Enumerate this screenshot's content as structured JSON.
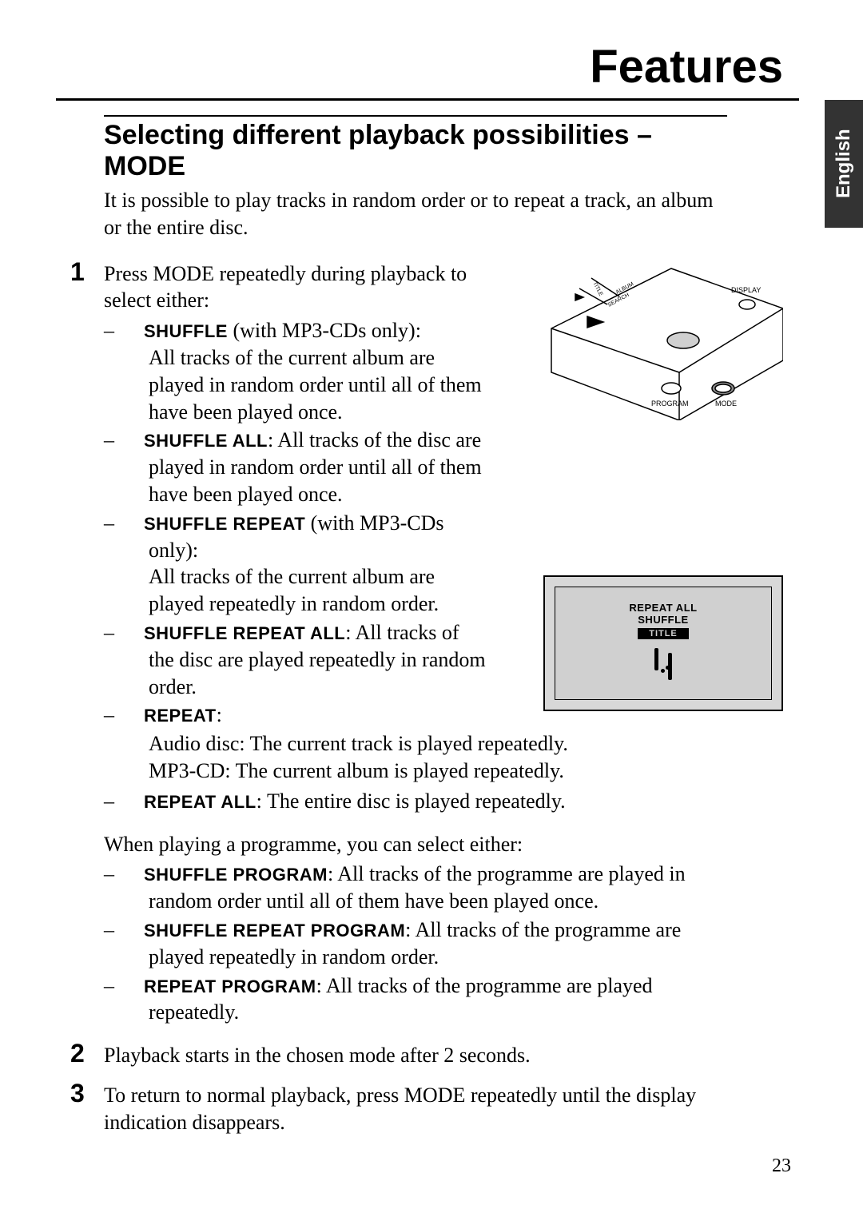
{
  "header": {
    "title": "Features"
  },
  "lang_tab": "English",
  "section": {
    "title": "Selecting different playback possibilities – MODE",
    "intro": "It is possible to play tracks in random order or to repeat a track, an album or the entire disc."
  },
  "step1": {
    "num": "1",
    "lead": "Press MODE repeatedly during playback to select either:",
    "modes": [
      {
        "name": "SHUFFLE",
        "suffix": " (with MP3-CDs only):",
        "desc": "All tracks of the current album are played in random order until all of them have been played once."
      },
      {
        "name": "SHUFFLE ALL",
        "suffix": ": ",
        "desc": "All tracks of the disc are played in random order until all of them have been played once."
      },
      {
        "name": "SHUFFLE REPEAT",
        "suffix": " (with MP3-CDs only):",
        "desc": "All tracks of the current album are played repeatedly in random order."
      },
      {
        "name": "SHUFFLE REPEAT ALL",
        "suffix": ": ",
        "desc": "All tracks of the disc are played repeatedly in random order."
      },
      {
        "name": "REPEAT",
        "suffix": ":",
        "desc": ""
      }
    ],
    "repeat_lines": [
      "Audio disc: The current track is played repeatedly.",
      "MP3-CD: The current album is played repeatedly."
    ],
    "repeat_all": {
      "name": "REPEAT ALL",
      "suffix": ": ",
      "desc": "The entire disc is played repeatedly."
    },
    "when_playing": "When playing a programme, you can select either:",
    "prog_modes": [
      {
        "name": "SHUFFLE PROGRAM",
        "suffix": ": ",
        "desc": "All tracks of the programme are played in random order until all of them have been played once."
      },
      {
        "name": "SHUFFLE REPEAT PROGRAM",
        "suffix": ": ",
        "desc": "All tracks of the programme are played repeatedly in random order."
      },
      {
        "name": "REPEAT PROGRAM",
        "suffix": ": ",
        "desc": "All tracks of the programme are played repeatedly."
      }
    ]
  },
  "step2": {
    "num": "2",
    "text": "Playback starts in the chosen mode after 2 seconds."
  },
  "step3": {
    "num": "3",
    "text": "To return to normal playback, press MODE repeatedly until the display indication disappears."
  },
  "illus1": {
    "labels": {
      "display": "DISPLAY",
      "program": "PROGRAM",
      "mode": "MODE",
      "search": "SEARCH",
      "album": "ALBUM",
      "title": "TITLE"
    }
  },
  "illus2": {
    "line1": "REPEAT ALL",
    "line2": "SHUFFLE",
    "title": "TITLE"
  },
  "page_number": "23"
}
